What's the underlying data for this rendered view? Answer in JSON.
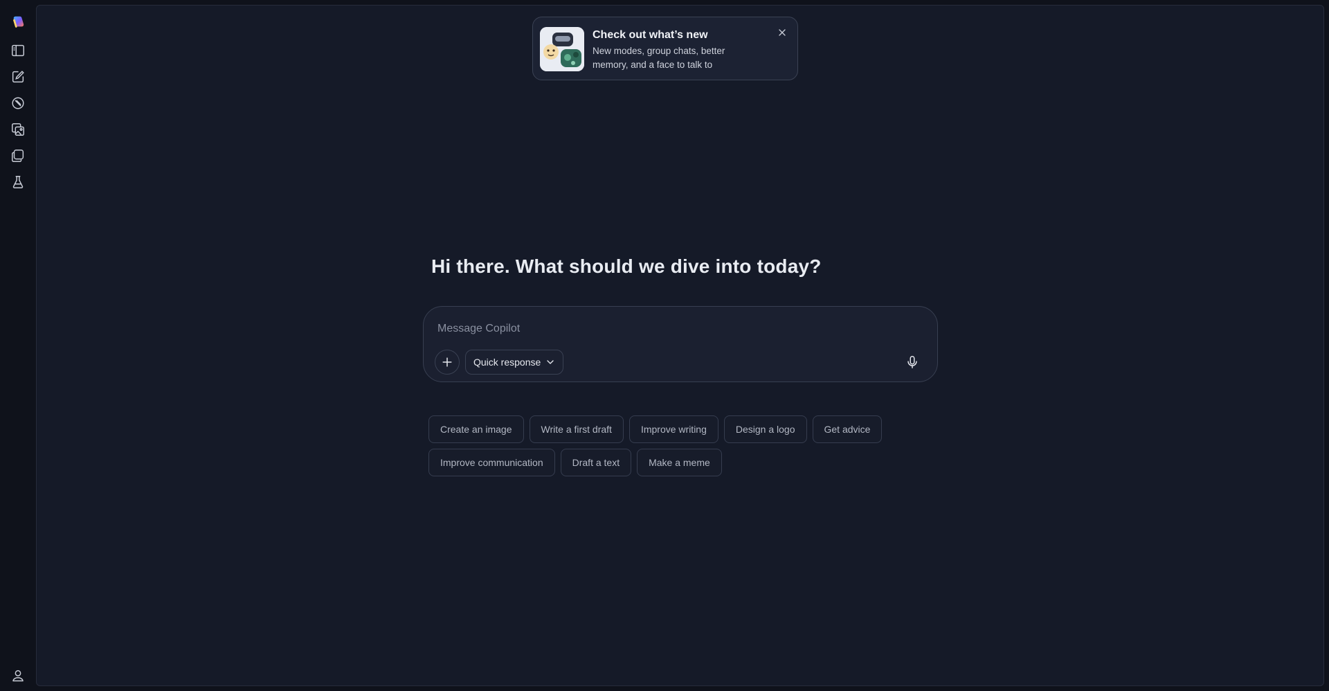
{
  "sidebar": {
    "items": [
      {
        "icon": "copilot-logo-icon"
      },
      {
        "icon": "sidebar-toggle-icon"
      },
      {
        "icon": "new-chat-icon"
      },
      {
        "icon": "discover-icon"
      },
      {
        "icon": "image-gallery-icon"
      },
      {
        "icon": "pages-icon"
      },
      {
        "icon": "labs-icon"
      }
    ],
    "profile_icon": "user-profile-icon"
  },
  "toast": {
    "title": "Check out what’s new",
    "body": "New modes, group chats, better memory, and a face to talk to",
    "close_icon": "close-icon"
  },
  "headline": "Hi there. What should we dive into today?",
  "composer": {
    "placeholder": "Message Copilot",
    "value": "",
    "add_icon": "plus-icon",
    "mode_label": "Quick response",
    "mode_icon": "chevron-down-icon",
    "mic_icon": "microphone-icon"
  },
  "suggestions": {
    "row1": [
      "Create an image",
      "Write a first draft",
      "Improve writing",
      "Design a logo",
      "Get advice"
    ],
    "row2": [
      "Improve communication",
      "Draft a text",
      "Make a meme"
    ]
  },
  "colors": {
    "background": "#0f121b",
    "panel": "#151a28",
    "composer": "#1b2030",
    "border": "#383f51"
  }
}
